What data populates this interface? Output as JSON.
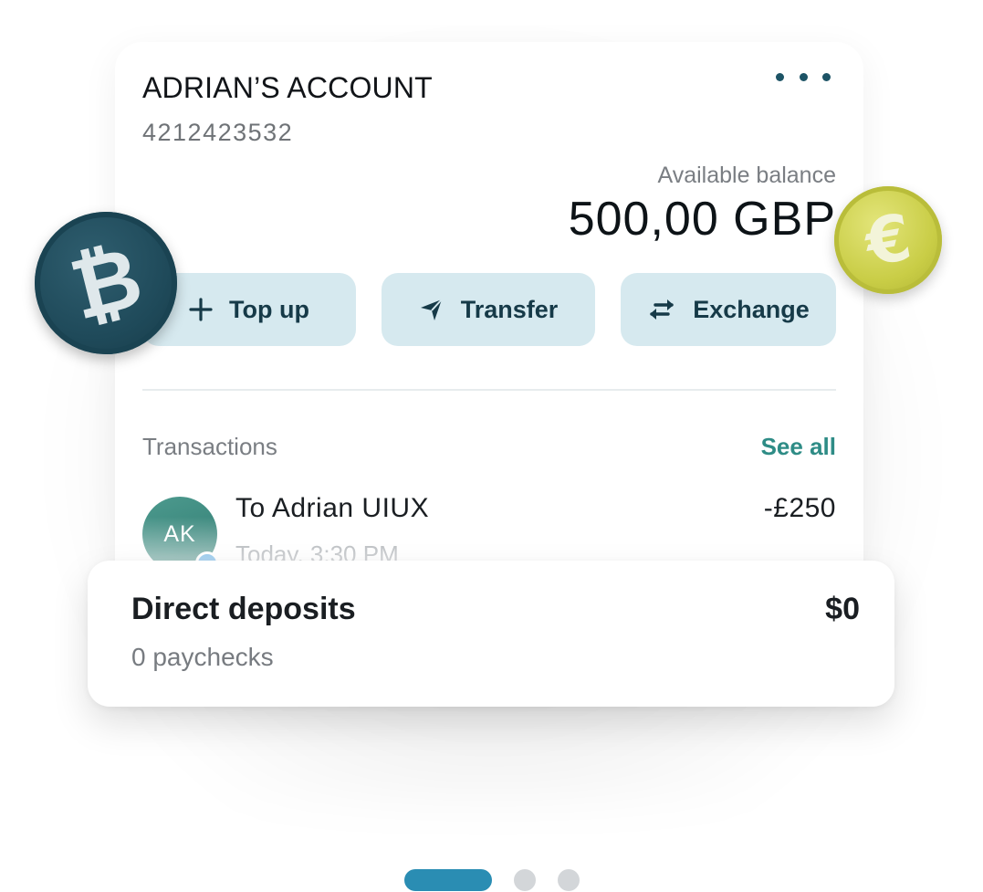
{
  "account": {
    "name": "ADRIAN’S ACCOUNT",
    "number": "4212423532",
    "more_icon": "more-horizontal-icon",
    "balance_label": "Available balance",
    "balance_amount": "500,00 GBP"
  },
  "actions": [
    {
      "label": "Top up",
      "icon": "plus-icon"
    },
    {
      "label": "Transfer",
      "icon": "send-icon"
    },
    {
      "label": "Exchange",
      "icon": "exchange-arrows-icon"
    }
  ],
  "transactions": {
    "heading": "Transactions",
    "see_all_label": "See all",
    "items": [
      {
        "avatar_initials": "AK",
        "title": "To Adrian UIUX",
        "time": "Today, 3:30 PM",
        "amount": "-£250"
      }
    ]
  },
  "direct_deposits": {
    "title": "Direct deposits",
    "subtitle": "0 paychecks",
    "amount": "$0"
  },
  "coins": [
    {
      "symbol": "₿",
      "icon": "bitcoin-coin-icon"
    },
    {
      "symbol": "€",
      "icon": "euro-coin-icon"
    }
  ],
  "pager": {
    "total": 3,
    "active_index": 0
  },
  "colors": {
    "accent": "#2e8c86",
    "button_bg": "#d6e9ef",
    "button_text": "#163a48",
    "pager_active": "#2a8db3",
    "bitcoin_coin": "#1f4a5a",
    "euro_coin": "#c9cd46",
    "avatar": "#3f8c80"
  }
}
